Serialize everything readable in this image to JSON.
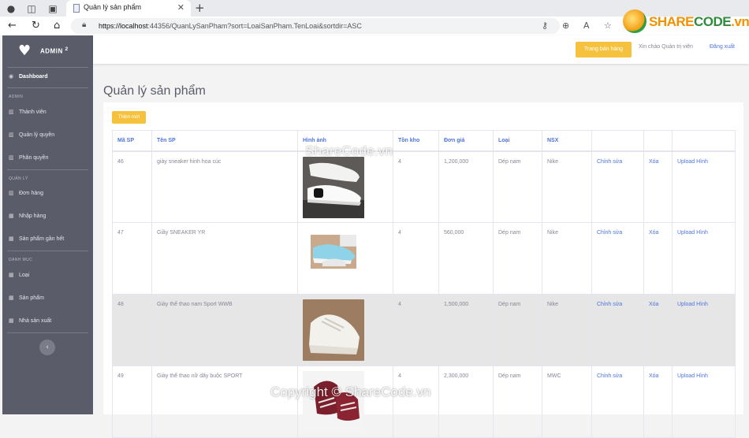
{
  "browser": {
    "tab_title": "Quản lý sản phẩm",
    "url_host": "https://localhost",
    "url_rest": ":44356/QuanLySanPham?sort=LoaiSanPham.TenLoai&sortdir=ASC"
  },
  "brand": {
    "name": "ADMIN",
    "sup": "2"
  },
  "watermark_logo": {
    "share": "SHARE",
    "code": "CODE",
    "vn": ".vn"
  },
  "sidebar": {
    "dashboard": "Dashboard",
    "section_admin": "ADMIN",
    "admin_items": [
      "Thành viên",
      "Quản lý quyền",
      "Phân quyền"
    ],
    "section_manage": "QUẢN LÝ",
    "manage_items": [
      "Đơn hàng",
      "Nhập hàng",
      "Sản phẩm gần hết"
    ],
    "section_catalog": "DANH MỤC",
    "catalog_items": [
      "Loại",
      "Sản phẩm",
      "Nhà sản xuất"
    ]
  },
  "topbar": {
    "store_button": "Trang bán hàng",
    "greeting": "Xin chào Quản trị viên",
    "logout": "Đăng xuất"
  },
  "page": {
    "title": "Quản lý sản phẩm",
    "add_button": "Thêm mới"
  },
  "table": {
    "headers": [
      "Mã SP",
      "Tên SP",
      "Hình ảnh",
      "Tồn kho",
      "Đơn giá",
      "Loại",
      "NSX",
      "",
      "",
      ""
    ],
    "rows": [
      {
        "id": "46",
        "name": "giày sneaker hinh hoa cúc",
        "image": "black-white-sneaker",
        "stock": "4",
        "price": "1,200,000",
        "type": "Dép nam",
        "maker": "Nike",
        "edit": "Chỉnh sửa",
        "delete": "Xóa",
        "upload": "Upload Hình"
      },
      {
        "id": "47",
        "name": "Giầy SNEAKER YR",
        "image": "blue-sneaker",
        "stock": "4",
        "price": "560,000",
        "type": "Dép nam",
        "maker": "Nike",
        "edit": "Chỉnh sửa",
        "delete": "Xóa",
        "upload": "Upload Hình"
      },
      {
        "id": "48",
        "name": "Giày thể thao nam Sport WWB",
        "image": "white-chunky-sneaker",
        "stock": "4",
        "price": "1,500,000",
        "type": "Dép nam",
        "maker": "Nike",
        "edit": "Chỉnh sửa",
        "delete": "Xóa",
        "upload": "Upload Hình"
      },
      {
        "id": "49",
        "name": "Giày thể thao nữ dây buộc SPORT",
        "image": "maroon-sock-sneaker",
        "stock": "4",
        "price": "2,300,000",
        "type": "Dép nam",
        "maker": "MWC",
        "edit": "Chỉnh sửa",
        "delete": "Xóa",
        "upload": "Upload Hình"
      }
    ]
  },
  "watermarks": {
    "top": "ShareCode.vn",
    "bottom": "Copyright © ShareCode.vn"
  },
  "colors": {
    "primary": "#4e73df",
    "warning": "#f6c23e",
    "sidebar": "#5a5c69",
    "text_muted": "#858796"
  }
}
